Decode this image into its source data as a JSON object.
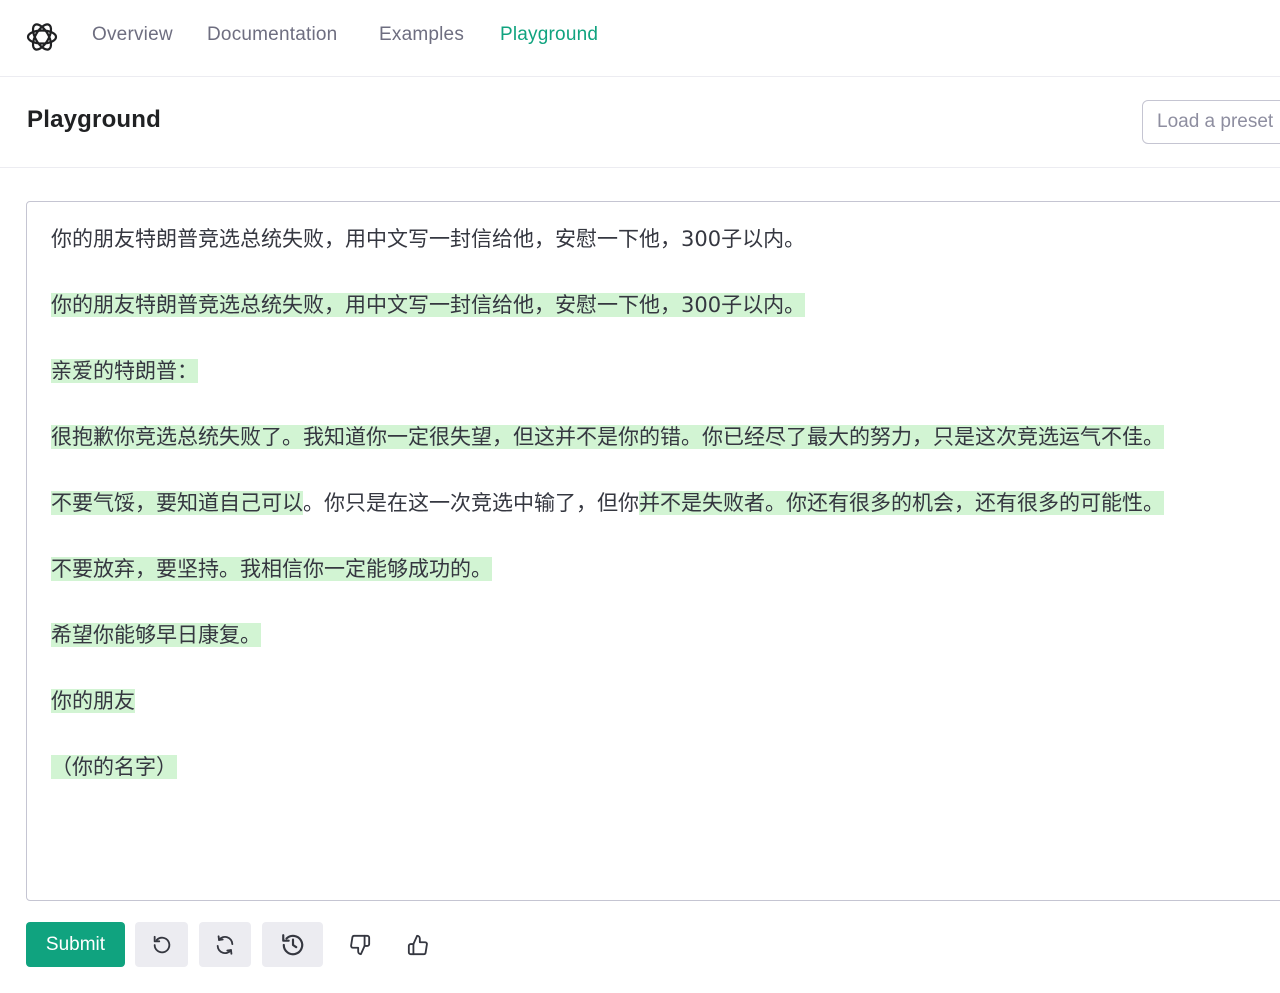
{
  "nav": {
    "logo_icon": "openai-logo-icon",
    "links": [
      "Overview",
      "Documentation",
      "Examples",
      "Playground"
    ],
    "active": "Playground",
    "active_color": "#10a37f"
  },
  "header": {
    "title": "Playground",
    "preset_label": "Load a preset"
  },
  "editor": {
    "prompt": "你的朋友特朗普竞选总统失败，用中文写一封信给他，安慰一下他，300子以内。",
    "completion_highlight_color": "#d2f4d3",
    "completion": [
      {
        "text": "你的朋友特朗普竞选总统失败，用中文写一封信给他，安慰一下他，300子以内。"
      },
      {
        "text": "亲爱的特朗普："
      },
      {
        "text": "很抱歉你竞选总统失败了。我知道你一定很失望，但这并不是你的错。你已经尽了最大的努力，只是这次竞选运气不佳。"
      },
      {
        "plain_a": "",
        "hl_a": "不要气馁，要知道自己可以",
        "plain_b": "。你只是在这一次竞选中输了，但你",
        "hl_b": "并不是失败者。你还有很多的机会，还有很多的可能性。"
      },
      {
        "text": "不要放弃，要坚持。我相信你一定能够成功的。"
      },
      {
        "text": "希望你能够早日康复。"
      },
      {
        "text": "你的朋友"
      },
      {
        "text": "（你的名字）"
      }
    ]
  },
  "toolbar": {
    "submit_label": "Submit",
    "submit_color": "#10a37f",
    "icons": [
      "undo-icon",
      "regenerate-icon",
      "history-icon",
      "thumbs-down-icon",
      "thumbs-up-icon"
    ]
  }
}
